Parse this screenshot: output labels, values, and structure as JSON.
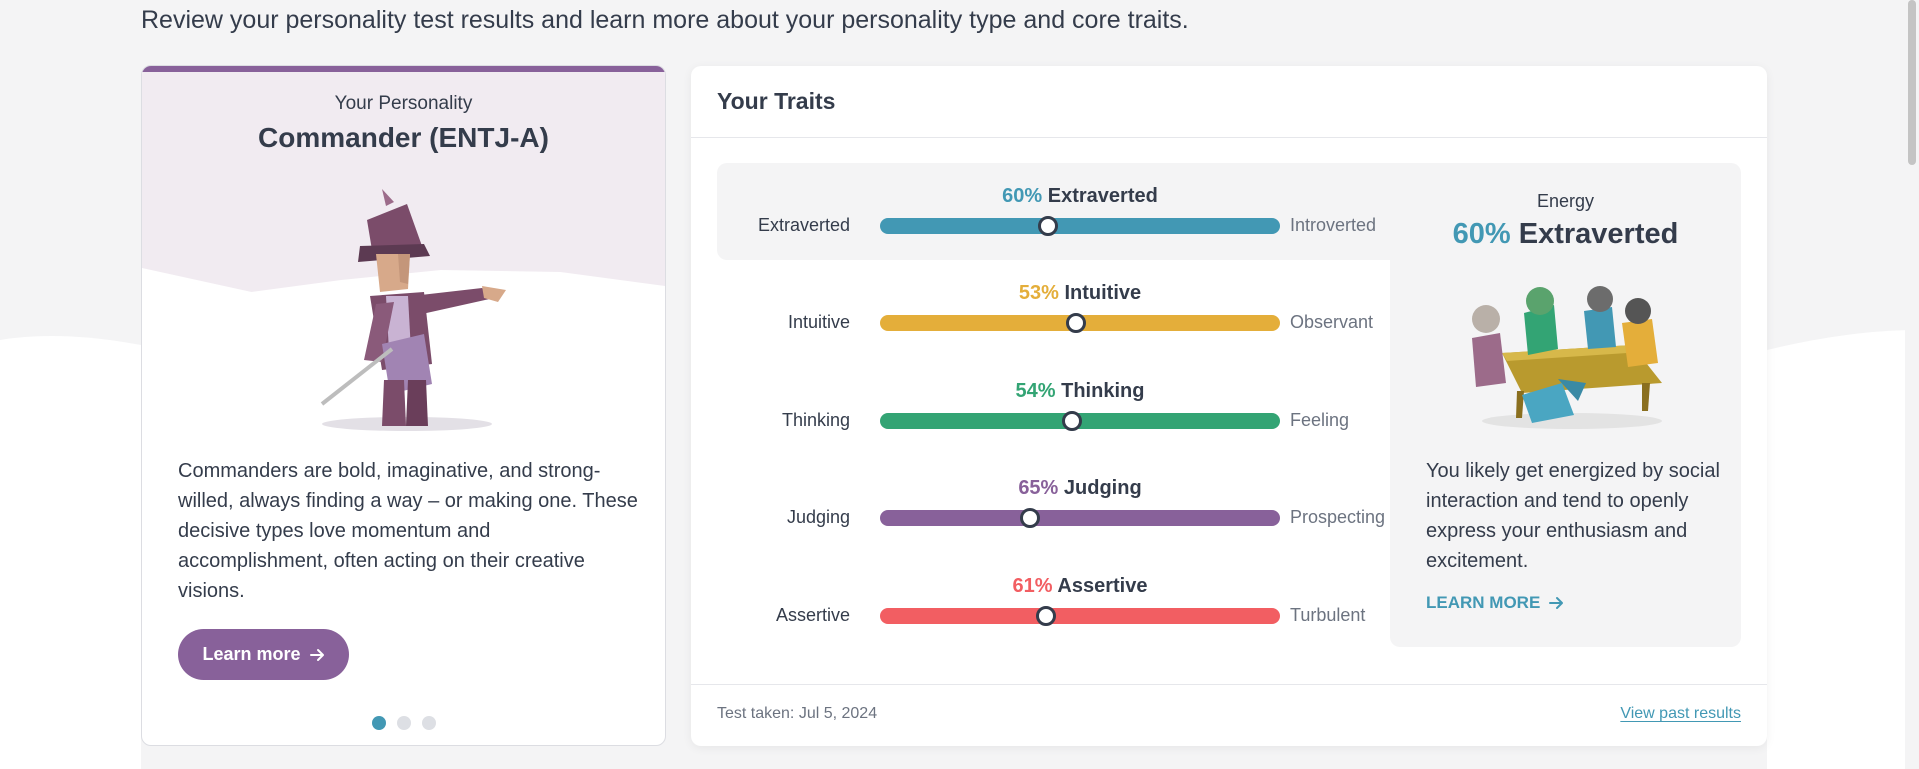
{
  "intro": "Review your personality test results and learn more about your personality type and core traits.",
  "personality_card": {
    "kicker": "Your Personality",
    "title": "Commander (ENTJ-A)",
    "description": "Commanders are bold, imaginative, and strong-willed, always finding a way – or making one. These decisive types love momentum and accomplishment, often acting on their creative visions.",
    "button_label": "Learn more",
    "accent_color": "#88619a"
  },
  "traits_card": {
    "title": "Your Traits",
    "traits": [
      {
        "pct_label": "60%",
        "name": "Extraverted",
        "left": "Extraverted",
        "right": "Introverted",
        "value": 0.42,
        "color": "#4298b4"
      },
      {
        "pct_label": "53%",
        "name": "Intuitive",
        "left": "Intuitive",
        "right": "Observant",
        "value": 0.49,
        "color": "#e4ae3a"
      },
      {
        "pct_label": "54%",
        "name": "Thinking",
        "left": "Thinking",
        "right": "Feeling",
        "value": 0.48,
        "color": "#33a474"
      },
      {
        "pct_label": "65%",
        "name": "Judging",
        "left": "Judging",
        "right": "Prospecting",
        "value": 0.375,
        "color": "#88619a"
      },
      {
        "pct_label": "61%",
        "name": "Assertive",
        "left": "Assertive",
        "right": "Turbulent",
        "value": 0.415,
        "color": "#f25e62"
      }
    ],
    "energy": {
      "label": "Energy",
      "pct": "60%",
      "name": "Extraverted",
      "text": "You likely get energized by social interaction and tend to openly express your enthusiasm and excitement.",
      "link": "LEARN MORE"
    },
    "test_taken": "Test taken: Jul 5, 2024",
    "past_results": "View past results"
  },
  "carousel": {
    "count": 3,
    "active": 0
  },
  "icons": {
    "arrow": "arrow-right-icon"
  }
}
